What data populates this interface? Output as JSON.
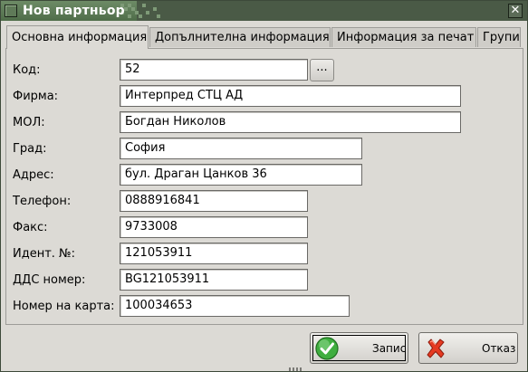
{
  "window": {
    "title": "Нов партньор",
    "close_icon": "close-icon",
    "app_icon": "window-icon"
  },
  "tabs": [
    {
      "label": "Основна информация",
      "active": true
    },
    {
      "label": "Допълнителна информация",
      "active": false
    },
    {
      "label": "Информация за печат",
      "active": false
    },
    {
      "label": "Групи",
      "active": false
    }
  ],
  "form": {
    "code": {
      "label": "Код:",
      "value": "52",
      "lookup_label": "..."
    },
    "company": {
      "label": "Фирма:",
      "value": "Интерпред СТЦ АД"
    },
    "mol": {
      "label": "МОЛ:",
      "value": "Богдан Николов"
    },
    "city": {
      "label": "Град:",
      "value": "София"
    },
    "address": {
      "label": "Адрес:",
      "value": "бул. Драган Цанков 36"
    },
    "phone": {
      "label": "Телефон:",
      "value": "0888916841"
    },
    "fax": {
      "label": "Факс:",
      "value": "9733008"
    },
    "ident": {
      "label": "Идент. №:",
      "value": "121053911"
    },
    "vat": {
      "label": "ДДС номер:",
      "value": "BG121053911"
    },
    "card": {
      "label": "Номер на карта:",
      "value": "100034653"
    }
  },
  "buttons": {
    "save": {
      "label": "Запис",
      "icon": "checkmark-icon",
      "color": "#2e9a2e"
    },
    "cancel": {
      "label": "Отказ",
      "icon": "cross-icon",
      "color": "#e0301e"
    }
  }
}
